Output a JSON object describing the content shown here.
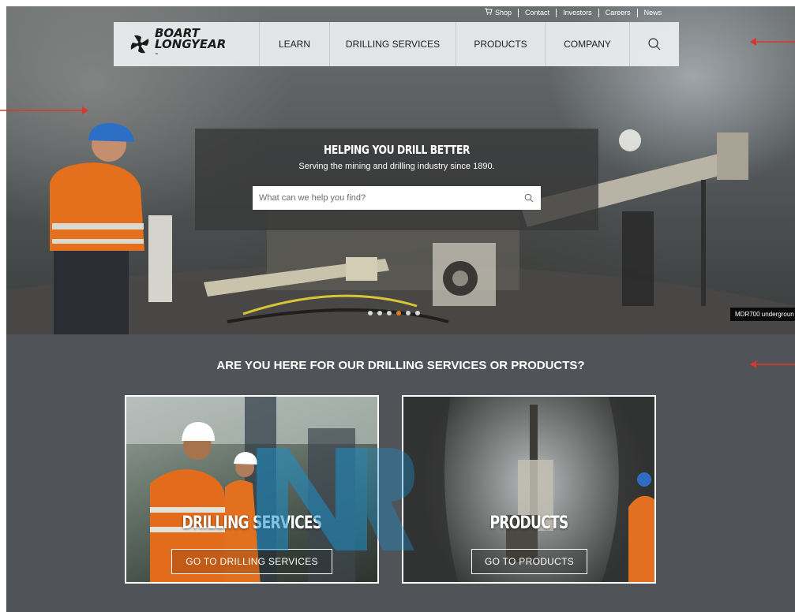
{
  "utility_nav": {
    "items": [
      {
        "label": "Shop"
      },
      {
        "label": "Contact"
      },
      {
        "label": "Investors"
      },
      {
        "label": "Careers"
      },
      {
        "label": "News"
      }
    ]
  },
  "logo": {
    "line1": "BOART",
    "line2": "LONGYEAR",
    "tm": "™"
  },
  "main_nav": {
    "items": [
      {
        "label": "LEARN"
      },
      {
        "label": "DRILLING SERVICES"
      },
      {
        "label": "PRODUCTS"
      },
      {
        "label": "COMPANY"
      }
    ]
  },
  "hero": {
    "title": "HELPING YOU DRILL BETTER",
    "subtitle": "Serving the mining and drilling industry since 1890.",
    "search_placeholder": "What can we help you find?",
    "caption": "MDR700 undergroun",
    "carousel": {
      "dot_count": 6,
      "active_dot": 3
    }
  },
  "section": {
    "heading": "ARE YOU HERE FOR OUR DRILLING SERVICES OR PRODUCTS?",
    "cards": [
      {
        "title": "DRILLING SERVICES",
        "button": "GO TO DRILLING SERVICES"
      },
      {
        "title": "PRODUCTS",
        "button": "GO TO PRODUCTS"
      }
    ]
  },
  "colors": {
    "accent": "#e07a1f",
    "section_bg": "#505459",
    "annotation": "#d9372b"
  }
}
